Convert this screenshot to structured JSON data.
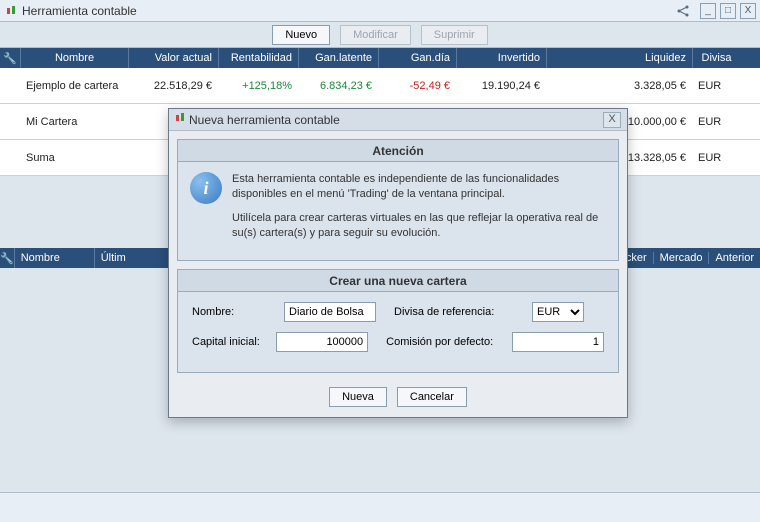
{
  "window": {
    "title": "Herramienta contable"
  },
  "toolbar": {
    "nuevo": "Nuevo",
    "modificar": "Modificar",
    "suprimir": "Suprimir"
  },
  "columns": {
    "nombre": "Nombre",
    "valor": "Valor actual",
    "rent": "Rentabilidad",
    "ganlat": "Gan.latente",
    "gandia": "Gan.día",
    "invertido": "Invertido",
    "liquidez": "Liquidez",
    "divisa": "Divisa"
  },
  "rows": [
    {
      "nombre": "Ejemplo de cartera",
      "valor": "22.518,29 €",
      "rent": "+125,18%",
      "ganlat": "6.834,23 €",
      "gandia": "-52,49 €",
      "invertido": "19.190,24 €",
      "liquidez": "3.328,05 €",
      "divisa": "EUR"
    },
    {
      "nombre": "Mi Cartera",
      "valor": "10.00",
      "rent": "",
      "ganlat": "",
      "gandia": "",
      "invertido": "",
      "liquidez": "10.000,00 €",
      "divisa": "EUR"
    },
    {
      "nombre": "Suma",
      "valor": "32.51",
      "rent": "",
      "ganlat": "",
      "gandia": "",
      "invertido": "",
      "liquidez": "13.328,05 €",
      "divisa": "EUR"
    }
  ],
  "sub_columns": {
    "nombre": "Nombre",
    "ultimo": "Últim",
    "ticker": "Ticker",
    "mercado": "Mercado",
    "anterior": "Anterior"
  },
  "modal": {
    "title": "Nueva herramienta contable",
    "atencion": "Atención",
    "info1": "Esta herramienta contable es independiente de las funcionalidades disponibles en el menú 'Trading' de la ventana principal.",
    "info2": "Utilícela para crear carteras virtuales en las que reflejar la operativa real de su(s) cartera(s) y para seguir su evolución.",
    "crear": "Crear una nueva cartera",
    "nombre_lbl": "Nombre:",
    "nombre_val": "Diario de Bolsa",
    "divisa_lbl": "Divisa de referencia:",
    "divisa_val": "EUR",
    "capital_lbl": "Capital inicial:",
    "capital_val": "100000",
    "comision_lbl": "Comisión por defecto:",
    "comision_val": "1",
    "nueva": "Nueva",
    "cancelar": "Cancelar"
  }
}
